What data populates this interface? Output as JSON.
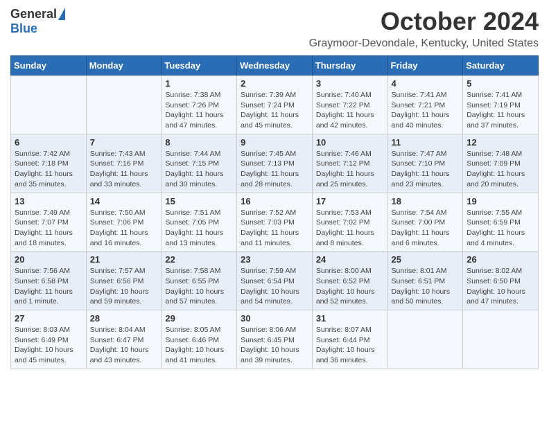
{
  "logo": {
    "general": "General",
    "blue": "Blue"
  },
  "title": "October 2024",
  "location": "Graymoor-Devondale, Kentucky, United States",
  "weekdays": [
    "Sunday",
    "Monday",
    "Tuesday",
    "Wednesday",
    "Thursday",
    "Friday",
    "Saturday"
  ],
  "weeks": [
    [
      {
        "day": "",
        "info": ""
      },
      {
        "day": "",
        "info": ""
      },
      {
        "day": "1",
        "info": "Sunrise: 7:38 AM\nSunset: 7:26 PM\nDaylight: 11 hours and 47 minutes."
      },
      {
        "day": "2",
        "info": "Sunrise: 7:39 AM\nSunset: 7:24 PM\nDaylight: 11 hours and 45 minutes."
      },
      {
        "day": "3",
        "info": "Sunrise: 7:40 AM\nSunset: 7:22 PM\nDaylight: 11 hours and 42 minutes."
      },
      {
        "day": "4",
        "info": "Sunrise: 7:41 AM\nSunset: 7:21 PM\nDaylight: 11 hours and 40 minutes."
      },
      {
        "day": "5",
        "info": "Sunrise: 7:41 AM\nSunset: 7:19 PM\nDaylight: 11 hours and 37 minutes."
      }
    ],
    [
      {
        "day": "6",
        "info": "Sunrise: 7:42 AM\nSunset: 7:18 PM\nDaylight: 11 hours and 35 minutes."
      },
      {
        "day": "7",
        "info": "Sunrise: 7:43 AM\nSunset: 7:16 PM\nDaylight: 11 hours and 33 minutes."
      },
      {
        "day": "8",
        "info": "Sunrise: 7:44 AM\nSunset: 7:15 PM\nDaylight: 11 hours and 30 minutes."
      },
      {
        "day": "9",
        "info": "Sunrise: 7:45 AM\nSunset: 7:13 PM\nDaylight: 11 hours and 28 minutes."
      },
      {
        "day": "10",
        "info": "Sunrise: 7:46 AM\nSunset: 7:12 PM\nDaylight: 11 hours and 25 minutes."
      },
      {
        "day": "11",
        "info": "Sunrise: 7:47 AM\nSunset: 7:10 PM\nDaylight: 11 hours and 23 minutes."
      },
      {
        "day": "12",
        "info": "Sunrise: 7:48 AM\nSunset: 7:09 PM\nDaylight: 11 hours and 20 minutes."
      }
    ],
    [
      {
        "day": "13",
        "info": "Sunrise: 7:49 AM\nSunset: 7:07 PM\nDaylight: 11 hours and 18 minutes."
      },
      {
        "day": "14",
        "info": "Sunrise: 7:50 AM\nSunset: 7:06 PM\nDaylight: 11 hours and 16 minutes."
      },
      {
        "day": "15",
        "info": "Sunrise: 7:51 AM\nSunset: 7:05 PM\nDaylight: 11 hours and 13 minutes."
      },
      {
        "day": "16",
        "info": "Sunrise: 7:52 AM\nSunset: 7:03 PM\nDaylight: 11 hours and 11 minutes."
      },
      {
        "day": "17",
        "info": "Sunrise: 7:53 AM\nSunset: 7:02 PM\nDaylight: 11 hours and 8 minutes."
      },
      {
        "day": "18",
        "info": "Sunrise: 7:54 AM\nSunset: 7:00 PM\nDaylight: 11 hours and 6 minutes."
      },
      {
        "day": "19",
        "info": "Sunrise: 7:55 AM\nSunset: 6:59 PM\nDaylight: 11 hours and 4 minutes."
      }
    ],
    [
      {
        "day": "20",
        "info": "Sunrise: 7:56 AM\nSunset: 6:58 PM\nDaylight: 11 hours and 1 minute."
      },
      {
        "day": "21",
        "info": "Sunrise: 7:57 AM\nSunset: 6:56 PM\nDaylight: 10 hours and 59 minutes."
      },
      {
        "day": "22",
        "info": "Sunrise: 7:58 AM\nSunset: 6:55 PM\nDaylight: 10 hours and 57 minutes."
      },
      {
        "day": "23",
        "info": "Sunrise: 7:59 AM\nSunset: 6:54 PM\nDaylight: 10 hours and 54 minutes."
      },
      {
        "day": "24",
        "info": "Sunrise: 8:00 AM\nSunset: 6:52 PM\nDaylight: 10 hours and 52 minutes."
      },
      {
        "day": "25",
        "info": "Sunrise: 8:01 AM\nSunset: 6:51 PM\nDaylight: 10 hours and 50 minutes."
      },
      {
        "day": "26",
        "info": "Sunrise: 8:02 AM\nSunset: 6:50 PM\nDaylight: 10 hours and 47 minutes."
      }
    ],
    [
      {
        "day": "27",
        "info": "Sunrise: 8:03 AM\nSunset: 6:49 PM\nDaylight: 10 hours and 45 minutes."
      },
      {
        "day": "28",
        "info": "Sunrise: 8:04 AM\nSunset: 6:47 PM\nDaylight: 10 hours and 43 minutes."
      },
      {
        "day": "29",
        "info": "Sunrise: 8:05 AM\nSunset: 6:46 PM\nDaylight: 10 hours and 41 minutes."
      },
      {
        "day": "30",
        "info": "Sunrise: 8:06 AM\nSunset: 6:45 PM\nDaylight: 10 hours and 39 minutes."
      },
      {
        "day": "31",
        "info": "Sunrise: 8:07 AM\nSunset: 6:44 PM\nDaylight: 10 hours and 36 minutes."
      },
      {
        "day": "",
        "info": ""
      },
      {
        "day": "",
        "info": ""
      }
    ]
  ]
}
